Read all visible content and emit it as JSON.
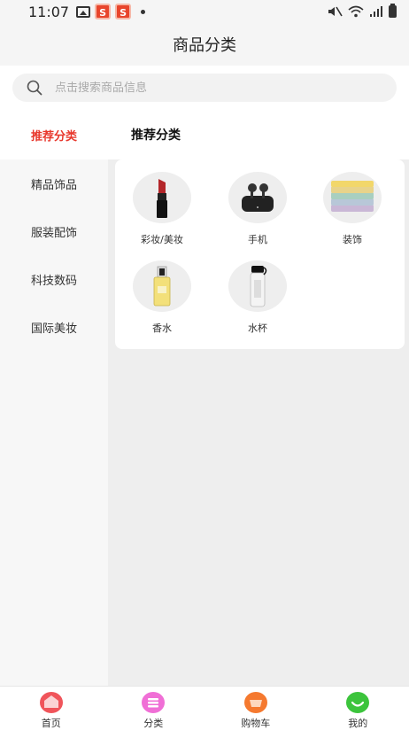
{
  "status_bar": {
    "time": "11:07",
    "app_badge_1": "S",
    "app_badge_2": "S"
  },
  "header": {
    "title": "商品分类"
  },
  "search": {
    "placeholder": "点击搜索商品信息"
  },
  "sidebar": {
    "items": [
      {
        "label": "推荐分类",
        "active": true
      },
      {
        "label": "精品饰品"
      },
      {
        "label": "服装配饰"
      },
      {
        "label": "科技数码"
      },
      {
        "label": "国际美妆"
      }
    ]
  },
  "main": {
    "section_title": "推荐分类",
    "categories": [
      {
        "label": "彩妆/美妆",
        "icon": "lipstick-icon"
      },
      {
        "label": "手机",
        "icon": "earbuds-icon"
      },
      {
        "label": "装饰",
        "icon": "towels-icon"
      },
      {
        "label": "香水",
        "icon": "perfume-icon"
      },
      {
        "label": "水杯",
        "icon": "water-bottle-icon"
      }
    ]
  },
  "tabbar": {
    "items": [
      {
        "label": "首页",
        "icon": "home-icon",
        "color": "#f0545a"
      },
      {
        "label": "分类",
        "icon": "category-icon",
        "color": "#f06fd6"
      },
      {
        "label": "购物车",
        "icon": "cart-icon",
        "color": "#f5792f"
      },
      {
        "label": "我的",
        "icon": "profile-icon",
        "color": "#3cc43c"
      }
    ]
  },
  "colors": {
    "accent": "#e8372c",
    "background": "#f5f5f5"
  }
}
